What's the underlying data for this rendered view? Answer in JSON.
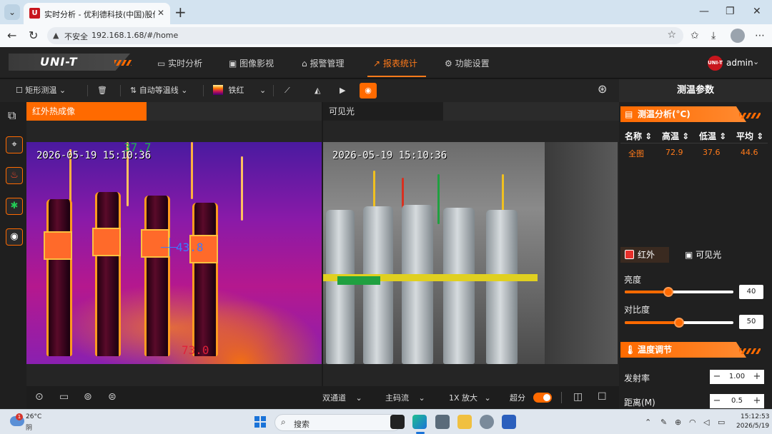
{
  "browser": {
    "tab_title": "实时分析 - 优利德科技(中国)股份有限公司",
    "favicon": "U",
    "url_warning": "不安全",
    "url": "192.168.1.68/#/home"
  },
  "app": {
    "logo": "UNI-T",
    "nav": [
      {
        "label": "实时分析",
        "icon": "monitor-icon"
      },
      {
        "label": "图像影视",
        "icon": "image-icon"
      },
      {
        "label": "报警管理",
        "icon": "alarm-icon"
      },
      {
        "label": "报表统计",
        "icon": "chart-icon",
        "active": true
      },
      {
        "label": "功能设置",
        "icon": "gear-icon"
      }
    ],
    "user": {
      "badge": "UNI-T",
      "name": "admin"
    },
    "accent_color": "#ff6a00"
  },
  "toolbar": {
    "measure_mode": "矩形测温",
    "isotherm": "自动等温线",
    "palette": "铁红"
  },
  "panels": {
    "infrared": {
      "label": "红外热成像",
      "timestamp": "2026-05-19 15:10:36",
      "temp_top": "37.7",
      "temp_mid": "43.8",
      "temp_bottom": "73.0"
    },
    "visible": {
      "label": "可见光",
      "timestamp": "2026-05-19 15:10:36"
    }
  },
  "bottom_bar": {
    "channel": "双通道",
    "stream": "主码流",
    "zoom": "1X 放大",
    "super_res_label": "超分",
    "super_res_on": true
  },
  "right_panel": {
    "title": "测温参数",
    "analysis": {
      "title": "测温分析(°C)",
      "columns": [
        "名称",
        "高温",
        "低温",
        "平均"
      ],
      "rows": [
        {
          "name": "全图",
          "high": "72.9",
          "low": "37.6",
          "avg": "44.6"
        }
      ]
    },
    "modes": {
      "infrared": "红外",
      "visible": "可见光"
    },
    "brightness": {
      "label": "亮度",
      "value": "40",
      "fraction": 0.4
    },
    "contrast": {
      "label": "对比度",
      "value": "50",
      "fraction": 0.5
    },
    "temp_adjust": {
      "title": "温度调节",
      "emissivity": {
        "label": "发射率",
        "value": "1.00"
      },
      "distance": {
        "label": "距离(M)",
        "value": "0.5"
      }
    }
  },
  "taskbar": {
    "weather_temp": "26°C",
    "weather_desc": "阴",
    "weather_badge": "1",
    "search": "搜索",
    "time": "15:12:53",
    "date": "2026/5/19"
  }
}
